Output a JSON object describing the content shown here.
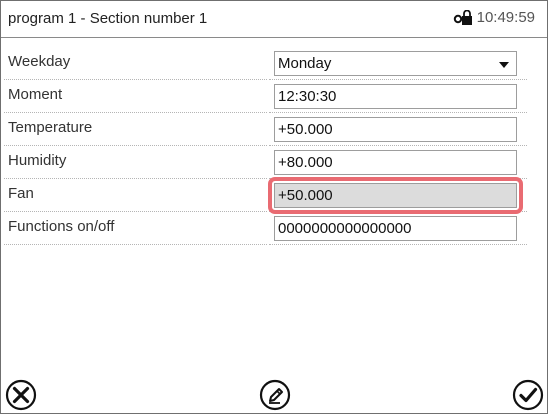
{
  "header": {
    "title": "program 1 - Section number 1",
    "time": "10:49:59",
    "lock_icon": "lock-key-icon"
  },
  "rows": [
    {
      "label": "Weekday",
      "value": "Monday",
      "type": "dropdown"
    },
    {
      "label": "Moment",
      "value": "12:30:30",
      "type": "text"
    },
    {
      "label": "Temperature",
      "value": "+50.000",
      "type": "text"
    },
    {
      "label": "Humidity",
      "value": "+80.000",
      "type": "text"
    },
    {
      "label": "Fan",
      "value": "+50.000",
      "type": "text",
      "selected": true
    },
    {
      "label": "Functions on/off",
      "value": "0000000000000000",
      "type": "text"
    }
  ],
  "bottom_bar": {
    "cancel_icon": "close-circle-icon",
    "edit_icon": "edit-pencil-icon",
    "confirm_icon": "checkmark-circle-icon"
  },
  "colors": {
    "highlight": "#e96b72",
    "selected_field": "#dcdcdc"
  }
}
